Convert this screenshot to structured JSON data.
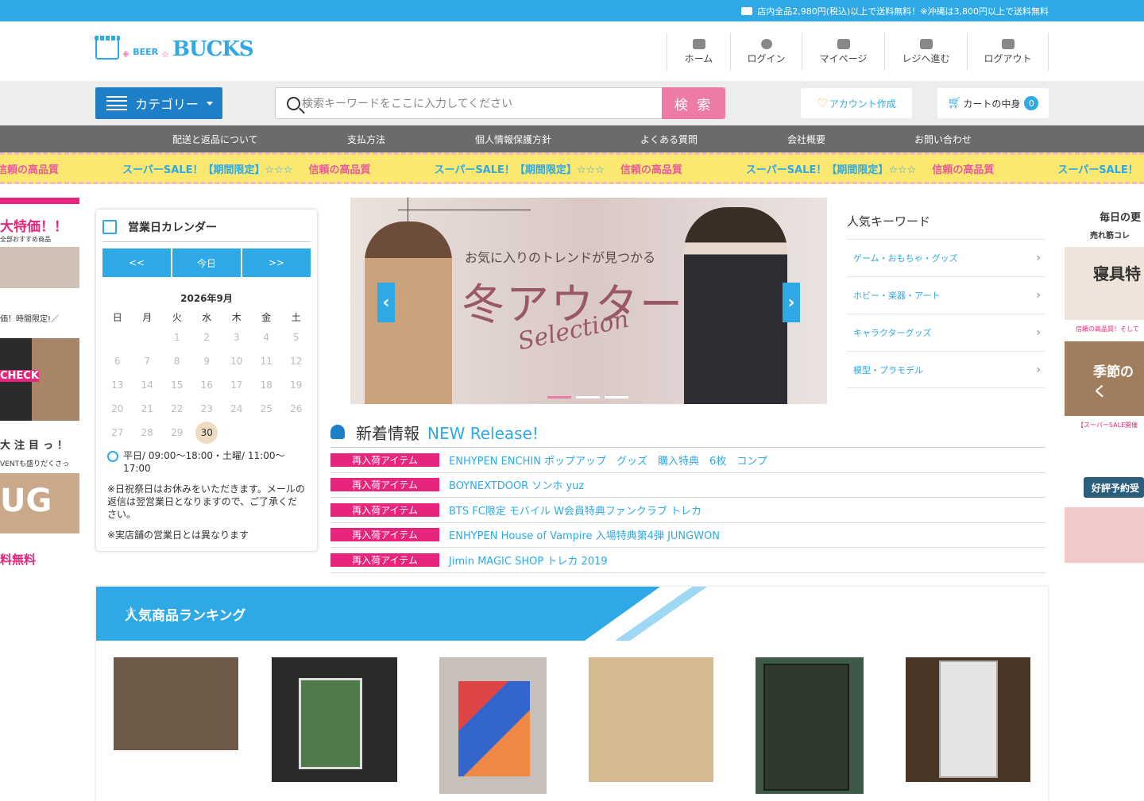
{
  "topbar": {
    "notice": "店内全品2,980円(税込)以上で送料無料！※沖縄は3,800円以上で送料無料"
  },
  "logo": {
    "small": "BEER",
    "big": "BUCKS"
  },
  "header_nav": [
    {
      "label": "ホーム",
      "icon": "home-icon"
    },
    {
      "label": "ログイン",
      "icon": "user-icon"
    },
    {
      "label": "マイページ",
      "icon": "id-card-icon"
    },
    {
      "label": "レジへ進む",
      "icon": "cash-icon"
    },
    {
      "label": "ログアウト",
      "icon": "logout-icon"
    }
  ],
  "search": {
    "category_label": "カテゴリー",
    "placeholder": "検索キーワードをここに入力してください",
    "button": "検 索"
  },
  "account": {
    "create_label": "アカウント作成",
    "cart_label": "カートの中身",
    "cart_count": "0"
  },
  "global_nav": [
    "配送と返品について",
    "支払方法",
    "個人情報保護方針",
    "よくある質問",
    "会社概要",
    "お問い合わせ"
  ],
  "banner": {
    "text1": "信頼の高品質",
    "text2": "スーパーSALE！【期間限定】☆☆☆"
  },
  "left_strip": {
    "t1": "大特価！！",
    "t2": "全部おすすめ商品",
    "t3": "価！時間限定!／",
    "t4": "CHECK",
    "t5": "大注目っ！",
    "t6": "VENTも盛りだくさっ",
    "t7": "UG",
    "t8": "料無料"
  },
  "right_strip": {
    "t1": "毎日の更",
    "t2": "売れ筋コレ",
    "t3": "寝具特",
    "t4": "信頼の高品質！そして",
    "t5": "季節のく",
    "t6": "【スーパーSALE開催",
    "t7": "好評予約受"
  },
  "calendar": {
    "title": "営業日カレンダー",
    "prev": "<<",
    "today": "今日",
    "next": ">>",
    "month": "2026年9月",
    "weekdays": [
      "日",
      "月",
      "火",
      "水",
      "木",
      "金",
      "土"
    ],
    "hours": "平日/ 09:00～18:00・土曜/ 11:00～17:00",
    "note1": "※日祝祭日はお休みをいただきます。メールの返信は翌営業日となりますので、ご了承ください。",
    "note2": "※実店舗の営業日とは異なります"
  },
  "slider": {
    "subtitle": "お気に入りのトレンドが見つかる",
    "title": "冬アウター",
    "script": "Selection"
  },
  "keywords": {
    "title": "人気キーワード",
    "items": [
      "ゲーム・おもちゃ・グッズ",
      "ホビー・楽器・アート",
      "キャラクターグッズ",
      "模型・プラモデル"
    ]
  },
  "news": {
    "title": "新着情報",
    "subtitle": "NEW Release!",
    "items": [
      {
        "tag": "再入荷アイテム",
        "text": "ENHYPEN ENCHIN ポップアップ　グッズ　購入特典　6枚　コンプ"
      },
      {
        "tag": "再入荷アイテム",
        "text": "BOYNEXTDOOR ソンホ yuz"
      },
      {
        "tag": "再入荷アイテム",
        "text": "BTS FC限定 モバイル W会員特典ファンクラブ トレカ"
      },
      {
        "tag": "再入荷アイテム",
        "text": "ENHYPEN House of Vampire 入場特典第4弾 JUNGWON"
      },
      {
        "tag": "再入荷アイテム",
        "text": "Jimin MAGIC SHOP トレカ 2019"
      }
    ]
  },
  "ranking": {
    "title": "人気商品ランキング"
  },
  "colors": {
    "accent": "#2fa9e6",
    "pink": "#ee7ba6",
    "tag": "#e8257c",
    "nav": "#6b6b6b"
  }
}
